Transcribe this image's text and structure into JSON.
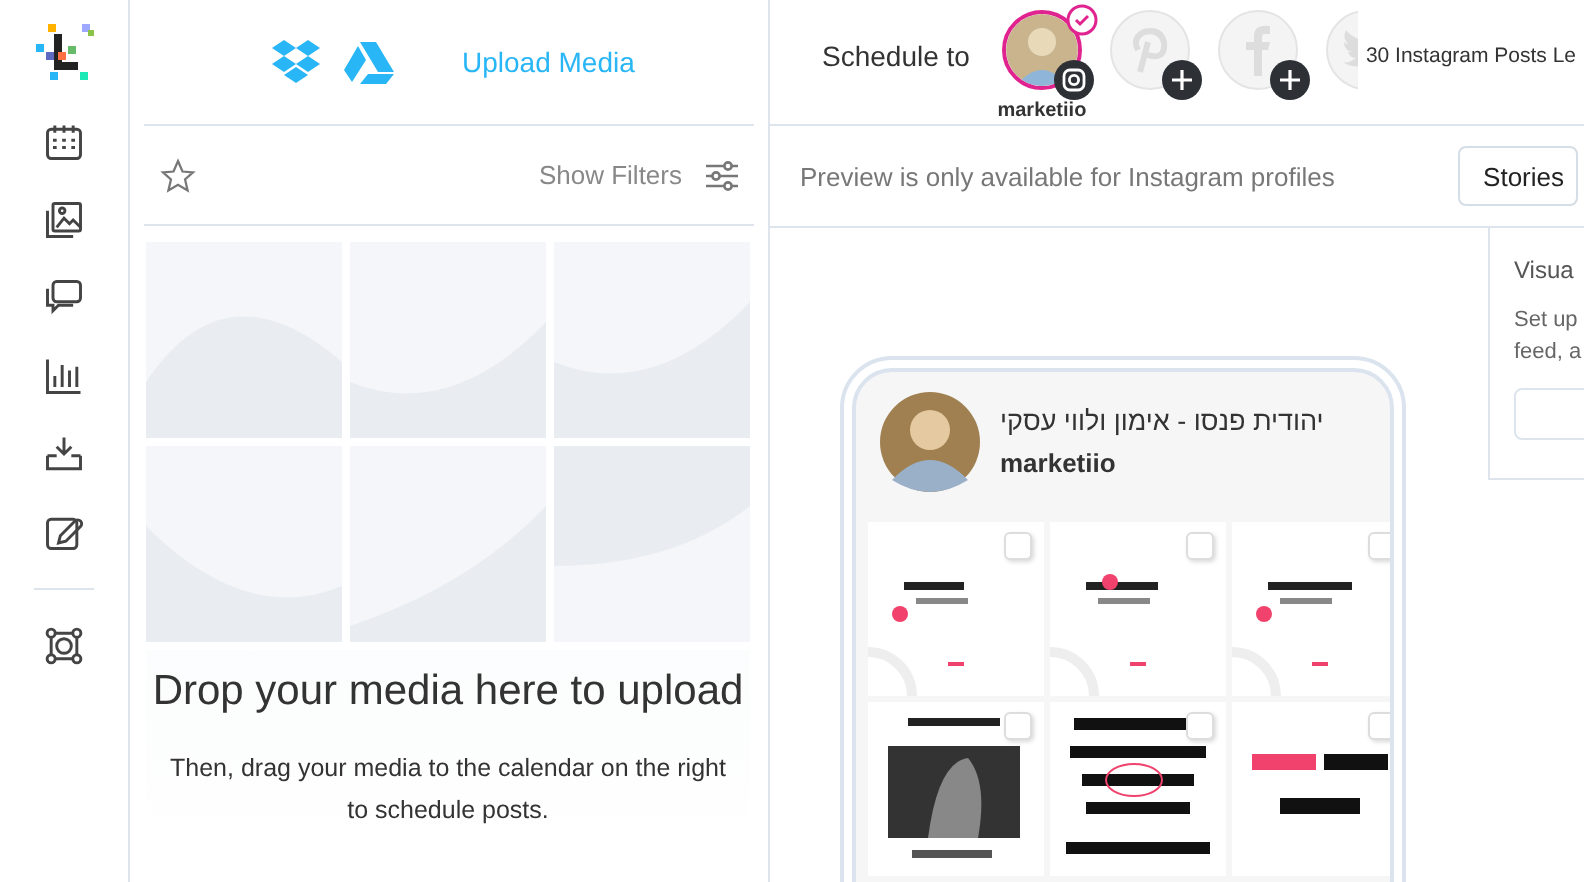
{
  "media_panel": {
    "upload_link": "Upload Media",
    "filters_label": "Show Filters",
    "drop_title": "Drop your media here to upload",
    "drop_hint": "Then, drag your media to the calendar on the right to schedule posts."
  },
  "schedule": {
    "label": "Schedule to",
    "profiles": [
      {
        "kind": "instagram",
        "selected": true,
        "name": "marketiio"
      },
      {
        "kind": "pinterest",
        "selected": false
      },
      {
        "kind": "facebook",
        "selected": false
      },
      {
        "kind": "twitter",
        "selected": false
      }
    ],
    "plan_text": "30 Instagram Posts Le"
  },
  "preview": {
    "notice": "Preview is only available for Instagram profiles",
    "stories_button": "Stories",
    "profile_name": "יהודית פנסו - אימון ולווי עסקי",
    "handle": "marketiio"
  },
  "side_panel": {
    "title": "Visua",
    "description": "Set up\nfeed, a"
  }
}
